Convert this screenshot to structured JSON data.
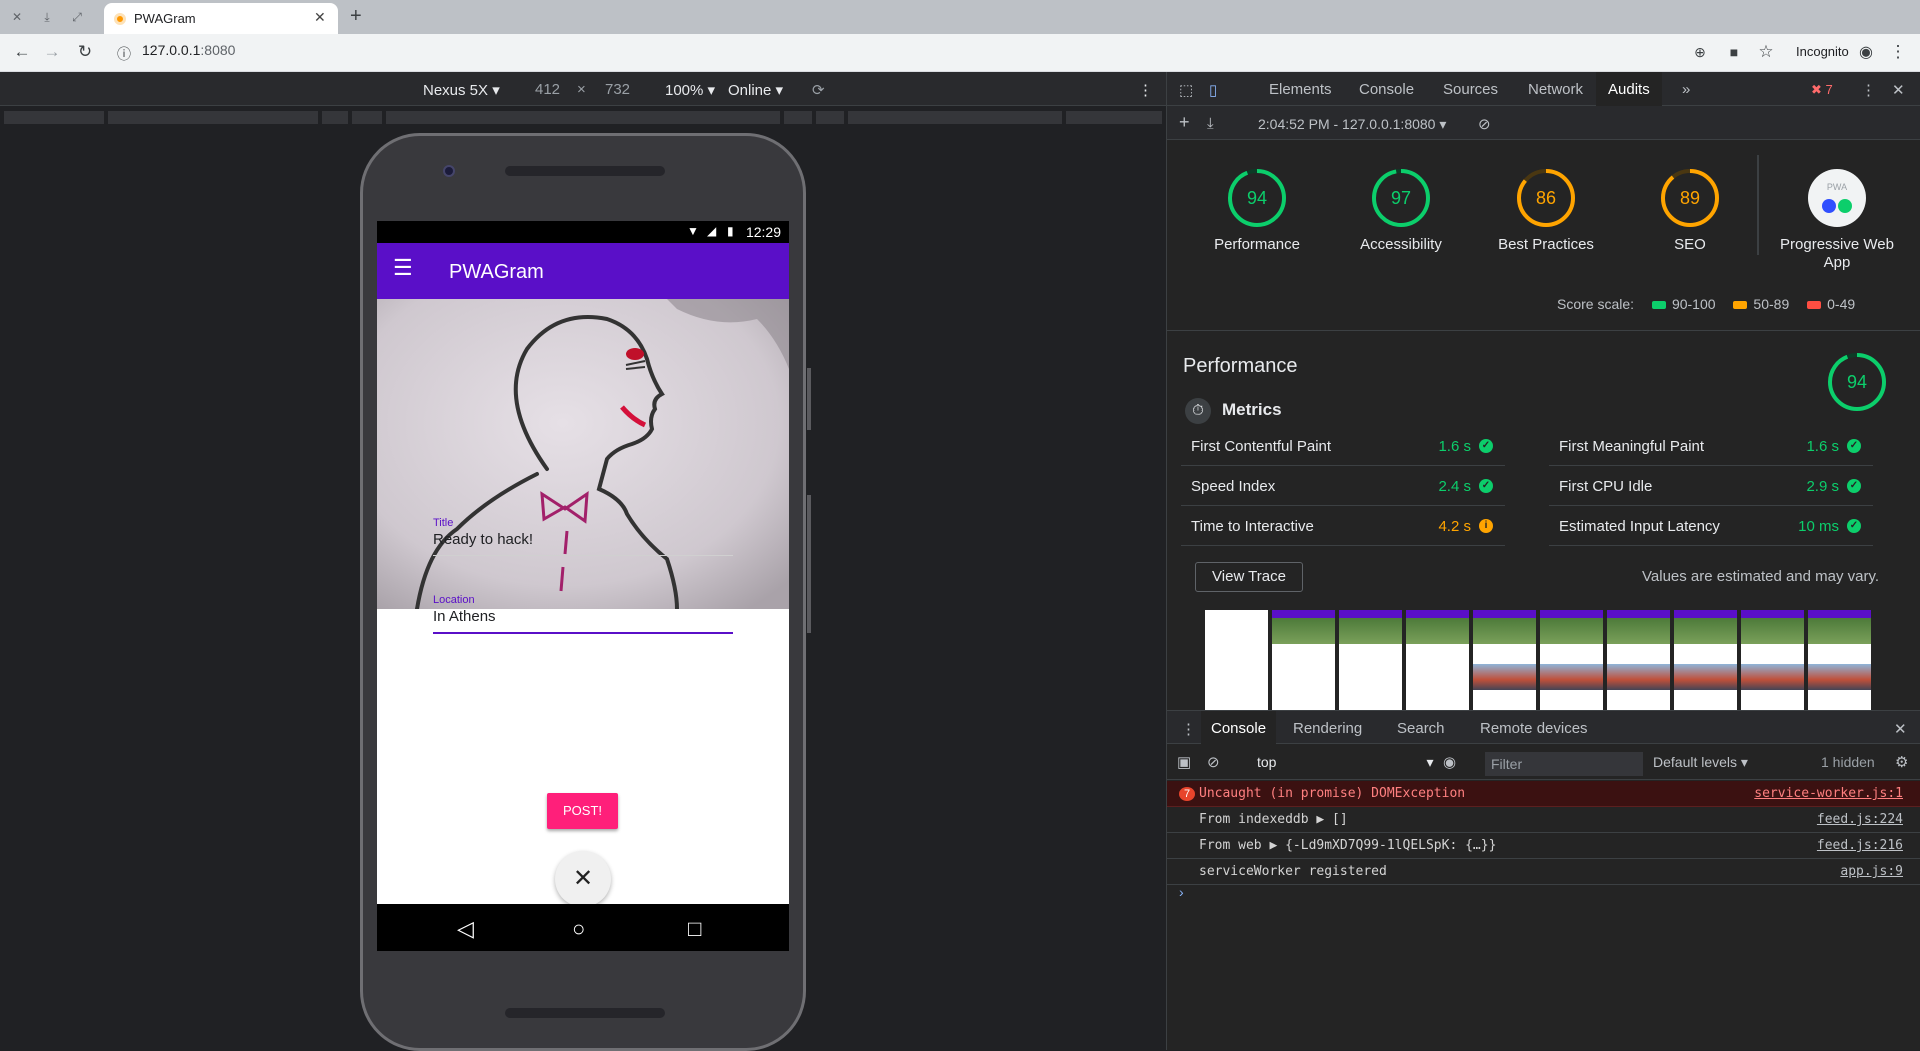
{
  "browser": {
    "tab_title": "PWAGram",
    "url_host": "127.0.0.1",
    "url_port": ":8080",
    "incognito_label": "Incognito"
  },
  "device_toolbar": {
    "device": "Nexus 5X",
    "width": "412",
    "times": "×",
    "height": "732",
    "zoom": "100%",
    "network": "Online"
  },
  "phone": {
    "clock": "12:29",
    "app_title": "PWAGram",
    "title_label": "Title",
    "title_value": "Ready to hack!",
    "location_label": "Location",
    "location_value": "In Athens",
    "post_button": "POST!"
  },
  "devtools": {
    "tabs": [
      "Elements",
      "Console",
      "Sources",
      "Network",
      "Audits"
    ],
    "error_count": "7",
    "report_selector": "2:04:52 PM - 127.0.0.1:8080",
    "gauges": [
      {
        "score": 94,
        "label": "Performance",
        "color": "#0cce6b"
      },
      {
        "score": 97,
        "label": "Accessibility",
        "color": "#0cce6b"
      },
      {
        "score": 86,
        "label": "Best Practices",
        "color": "#ffa400"
      },
      {
        "score": 89,
        "label": "SEO",
        "color": "#ffa400"
      }
    ],
    "pwa_label": "Progressive Web App",
    "pwa_badge_text": "PWA",
    "score_scale_label": "Score scale:",
    "scale": [
      {
        "range": "90-100",
        "color": "#0cce6b"
      },
      {
        "range": "50-89",
        "color": "#ffa400"
      },
      {
        "range": "0-49",
        "color": "#ff4e42"
      }
    ],
    "performance_title": "Performance",
    "performance_score": "94",
    "metrics_title": "Metrics",
    "metrics_left": [
      {
        "name": "First Contentful Paint",
        "value": "1.6 s",
        "status": "pass"
      },
      {
        "name": "Speed Index",
        "value": "2.4 s",
        "status": "pass"
      },
      {
        "name": "Time to Interactive",
        "value": "4.2 s",
        "status": "average"
      }
    ],
    "metrics_right": [
      {
        "name": "First Meaningful Paint",
        "value": "1.6 s",
        "status": "pass"
      },
      {
        "name": "First CPU Idle",
        "value": "2.9 s",
        "status": "pass"
      },
      {
        "name": "Estimated Input Latency",
        "value": "10 ms",
        "status": "pass"
      }
    ],
    "view_trace": "View Trace",
    "estimate_note": "Values are estimated and may vary.",
    "drawer_tabs": [
      "Console",
      "Rendering",
      "Search",
      "Remote devices"
    ],
    "context": "top",
    "filter_placeholder": "Filter",
    "levels": "Default levels",
    "hidden": "1 hidden",
    "console": [
      {
        "msg": "Uncaught (in promise) DOMException",
        "src": "service-worker.js:1",
        "level": "error",
        "count": "7"
      },
      {
        "msg": "From indexeddb ▶ []",
        "src": "feed.js:224",
        "level": "log"
      },
      {
        "msg": "From web ▶ {-Ld9mXD7Q99-1lQELSpK: {…}}",
        "src": "feed.js:216",
        "level": "log"
      },
      {
        "msg": "serviceWorker registered",
        "src": "app.js:9",
        "level": "log"
      }
    ]
  }
}
